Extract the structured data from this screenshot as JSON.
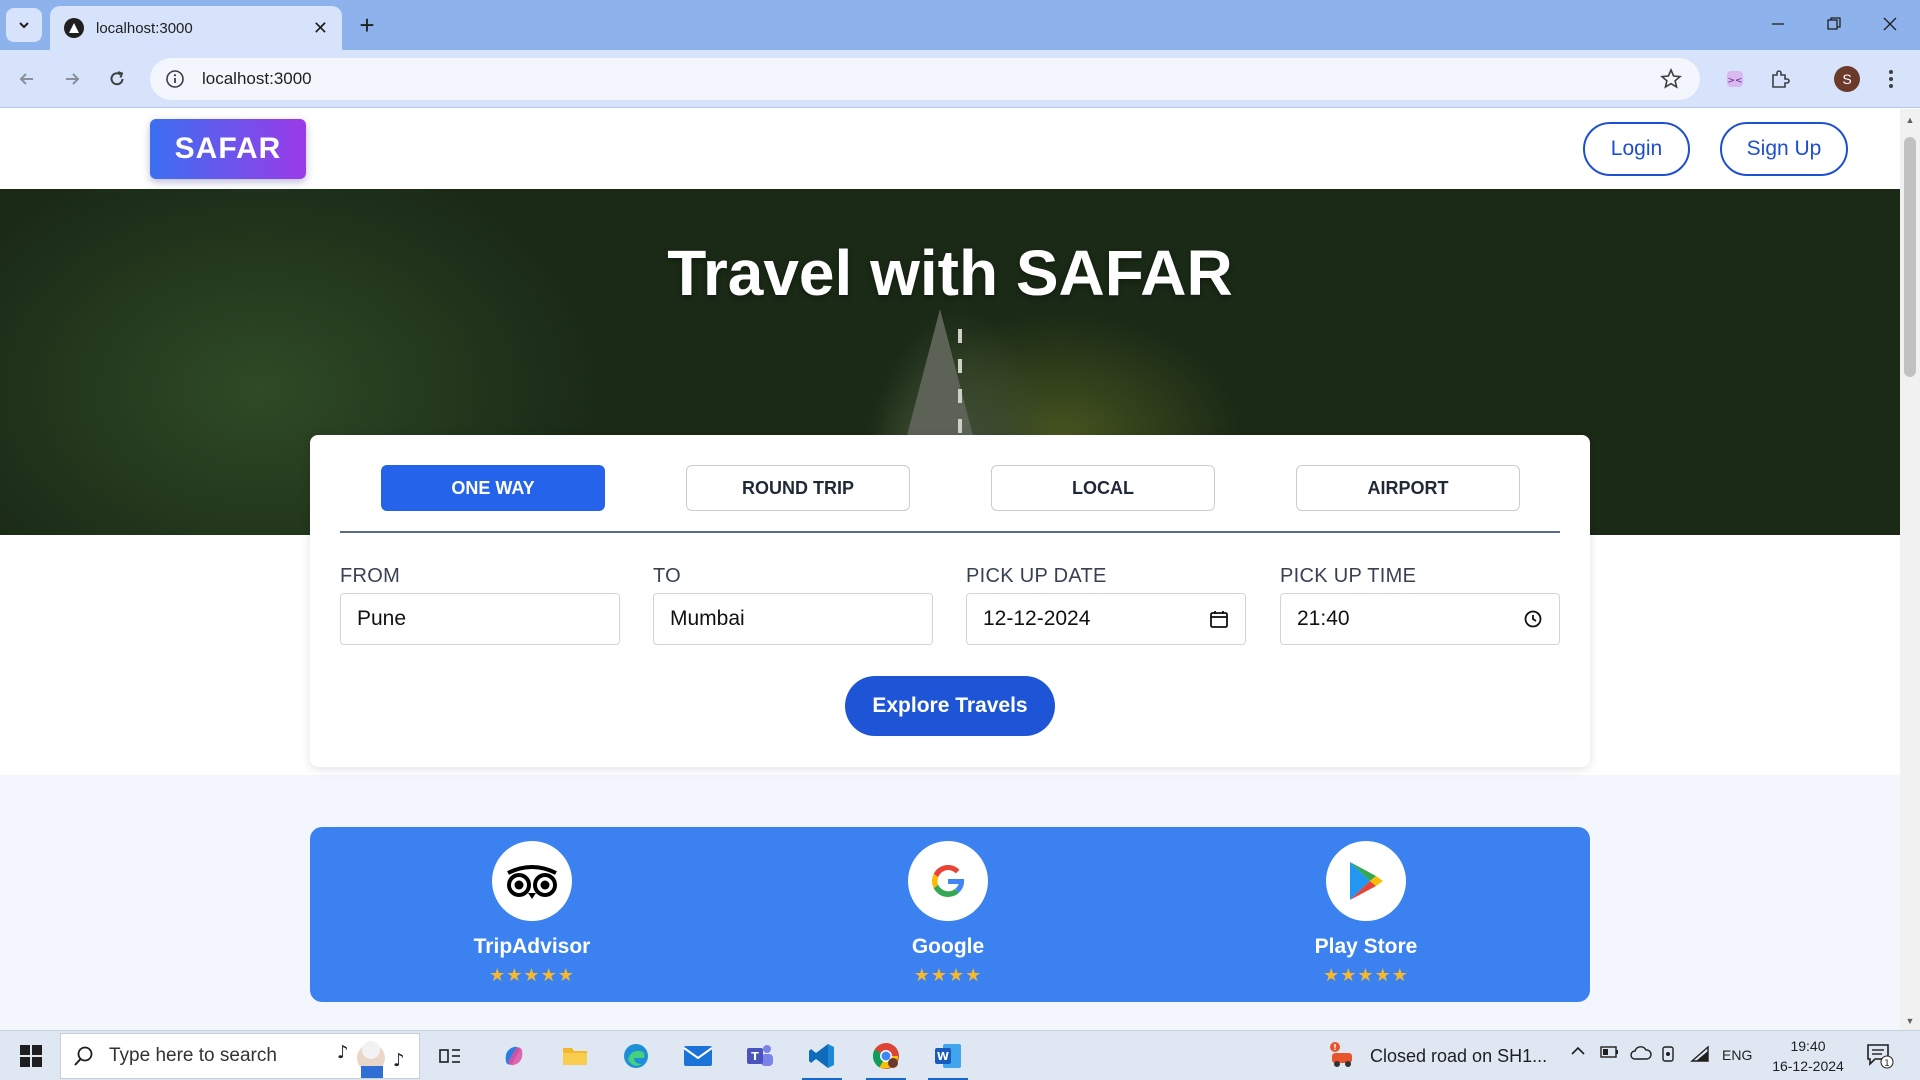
{
  "browser": {
    "tab_title": "localhost:3000",
    "url": "localhost:3000",
    "profile_initial": "S"
  },
  "site": {
    "logo": "SAFAR",
    "login_label": "Login",
    "signup_label": "Sign Up"
  },
  "hero": {
    "title": "Travel with SAFAR"
  },
  "booking": {
    "tabs": [
      {
        "label": "ONE WAY",
        "active": true
      },
      {
        "label": "ROUND TRIP",
        "active": false
      },
      {
        "label": "LOCAL",
        "active": false
      },
      {
        "label": "AIRPORT",
        "active": false
      }
    ],
    "from_label": "FROM",
    "from_value": "Pune",
    "to_label": "TO",
    "to_value": "Mumbai",
    "date_label": "PICK UP DATE",
    "date_value": "12-12-2024",
    "time_label": "PICK UP TIME",
    "time_value": "21:40",
    "explore_label": "Explore Travels"
  },
  "ratings": [
    {
      "name": "TripAdvisor",
      "stars": 5,
      "stars_text": "★★★★★",
      "icon": "tripadvisor-icon"
    },
    {
      "name": "Google",
      "stars": 4,
      "stars_text": "★★★★",
      "icon": "google-icon"
    },
    {
      "name": "Play Store",
      "stars": 5,
      "stars_text": "★★★★★",
      "icon": "play-store-icon"
    }
  ],
  "taskbar": {
    "search_placeholder": "Type here to search",
    "news": "Closed road on SH1...",
    "language": "ENG",
    "time": "19:40",
    "date": "16-12-2024",
    "notification_count": "1"
  },
  "colors": {
    "primary": "#2563eb",
    "ratings_bg": "#3b82f0",
    "star": "#f5b82e"
  }
}
